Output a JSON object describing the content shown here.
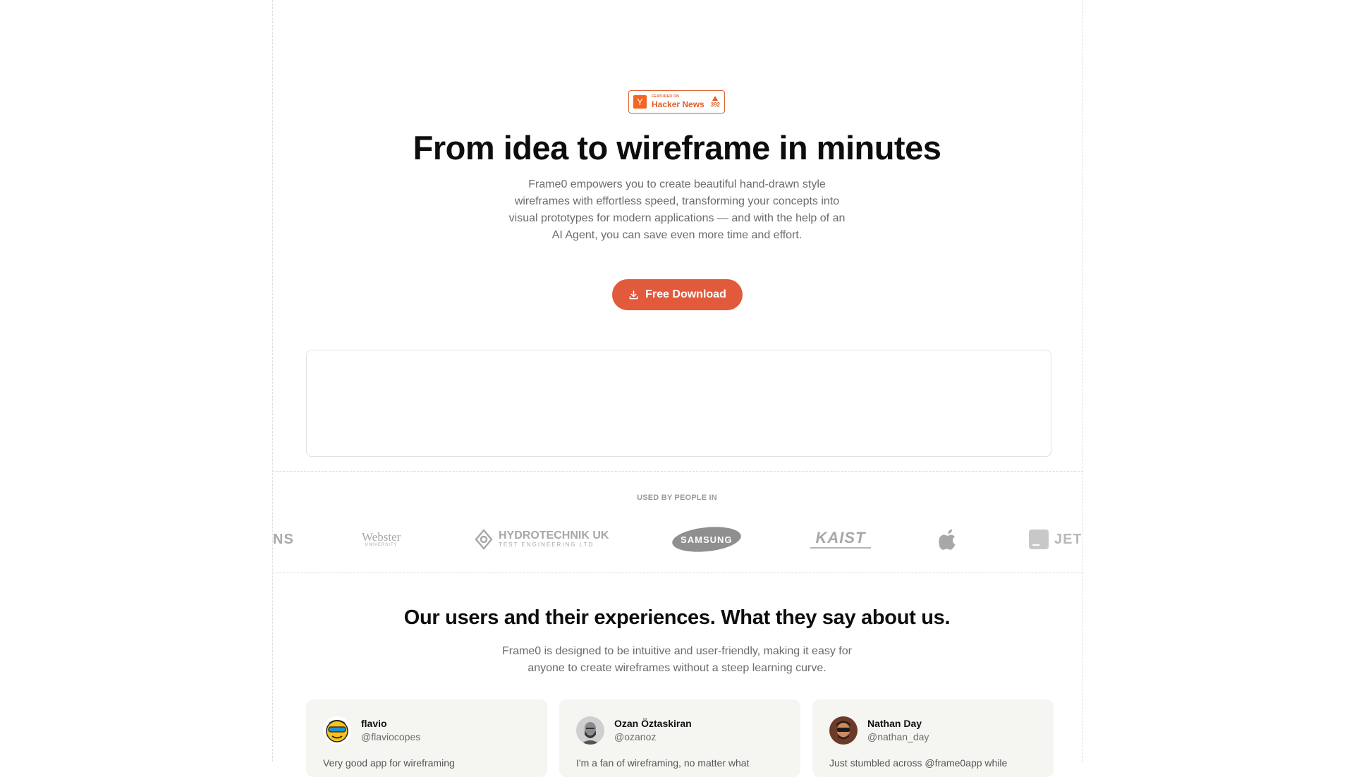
{
  "hn_badge": {
    "featured": "FEATURED ON",
    "name": "Hacker News",
    "votes": "392",
    "logo_letter": "Y"
  },
  "hero": {
    "title": "From idea to wireframe in minutes",
    "description": "Frame0 empowers you to create beautiful hand-drawn style wireframes with effortless speed, transforming your concepts into visual prototypes for modern applications — and with the help of an AI Agent, you can save even more time and effort.",
    "cta_label": "Free Download",
    "cta_icon": "download-icon"
  },
  "used_by": {
    "label": "USED BY PEOPLE IN",
    "logos": [
      {
        "name": "NS"
      },
      {
        "name": "Webster",
        "sub": "UNIVERSITY"
      },
      {
        "name": "HYDROTECHNIK UK",
        "sub": "TEST ENGINEERING LTD"
      },
      {
        "name": "SAMSUNG"
      },
      {
        "name": "KAIST"
      },
      {
        "name": "apple-logo-icon"
      },
      {
        "name": "JETBR"
      }
    ]
  },
  "testimonials": {
    "title": "Our users and their experiences. What they say about us.",
    "subtitle": "Frame0 is designed to be intuitive and user-friendly, making it easy for anyone to create wireframes without a steep learning curve.",
    "items": [
      {
        "name": "flavio",
        "handle": "@flaviocopes",
        "text": "Very good app for wireframing"
      },
      {
        "name": "Ozan Öztaskiran",
        "handle": "@ozanoz",
        "text": "I'm a fan of wireframing, no matter what"
      },
      {
        "name": "Nathan Day",
        "handle": "@nathan_day",
        "text": "Just stumbled across @frame0app while"
      }
    ]
  },
  "colors": {
    "accent": "#e25a3c",
    "hn_orange": "#f26522",
    "card_bg": "#f5f5f1"
  }
}
